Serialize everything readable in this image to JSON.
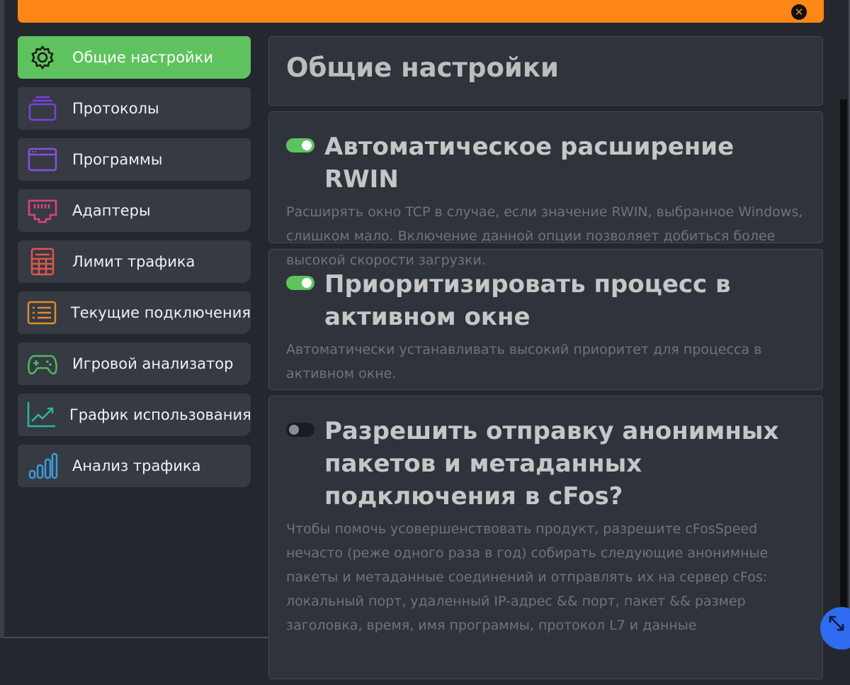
{
  "window": {
    "close_icon": "close-circle-icon"
  },
  "sidebar": {
    "items": [
      {
        "label": "Общие настройки",
        "icon": "gear-icon",
        "color": "#1a1a1a",
        "active": true
      },
      {
        "label": "Протоколы",
        "icon": "stack-icon",
        "color": "#7b3fe4"
      },
      {
        "label": "Программы",
        "icon": "window-icon",
        "color": "#8a4fe0"
      },
      {
        "label": "Адаптеры",
        "icon": "ethernet-port-icon",
        "color": "#e0407f"
      },
      {
        "label": "Лимит трафика",
        "icon": "calculator-icon",
        "color": "#e0564c"
      },
      {
        "label": "Текущие подключения",
        "icon": "list-icon",
        "color": "#e08a2a"
      },
      {
        "label": "Игровой анализатор",
        "icon": "gamepad-icon",
        "color": "#4dbb5a"
      },
      {
        "label": "График использования",
        "icon": "line-chart-icon",
        "color": "#2fb3a0"
      },
      {
        "label": "Анализ трафика",
        "icon": "bar-chart-icon",
        "color": "#3b9ddc"
      }
    ]
  },
  "main": {
    "page_title": "Общие настройки",
    "options": [
      {
        "title": "Автоматическое расширение RWIN",
        "enabled": true,
        "description": "Расширять окно TCP в случае, если значение RWIN, выбранное Windows, слишком мало. Включение данной опции позволяет добиться более высокой скорости загрузки."
      },
      {
        "title": "Приоритизировать процесс в активном окне",
        "enabled": true,
        "description": "Автоматически устанавливать высокий приоритет для процесса в активном окне."
      },
      {
        "title": "Разрешить отправку анонимных пакетов и метаданных подключения в cFos?",
        "enabled": false,
        "description": "Чтобы помочь усовершенствовать продукт, разрешите cFosSpeed нечасто (реже одного раза в год) собирать следующие анонимные пакеты и метаданные соединений и отправлять их на сервер cFos: локальный порт, удаленный IP-адрес && порт, пакет && размер заголовка, время, имя программы, протокол L7 и данные"
      }
    ]
  },
  "colors": {
    "accent_orange": "#ff8617",
    "active_green": "#5ec35f",
    "toggle_on": "#5ec35f",
    "fab_blue": "#2f6bf0"
  },
  "resize_icon": "resize-arrows-icon"
}
